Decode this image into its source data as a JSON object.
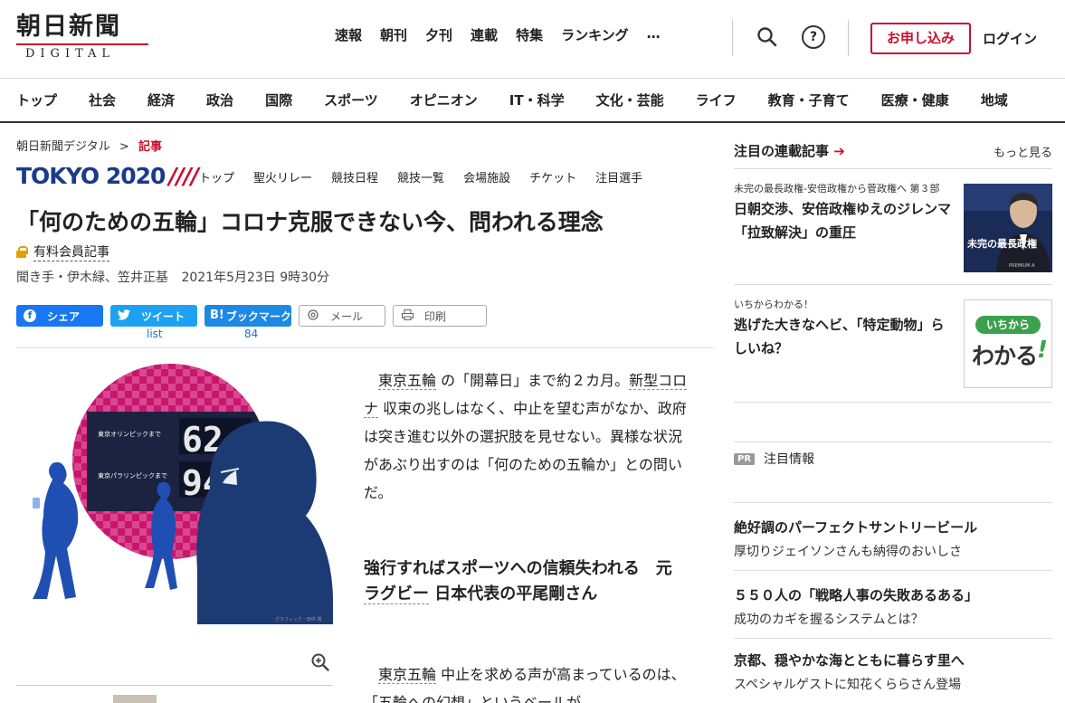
{
  "header": {
    "logo_main": "朝日新聞",
    "logo_sub": "DIGITAL",
    "topnav": [
      "速報",
      "朝刊",
      "夕刊",
      "連載",
      "特集",
      "ランキング"
    ],
    "more": "…",
    "help": "?",
    "apply": "お申し込み",
    "login": "ログイン"
  },
  "catnav": [
    "トップ",
    "社会",
    "経済",
    "政治",
    "国際",
    "スポーツ",
    "オピニオン",
    "IT・科学",
    "文化・芸能",
    "ライフ",
    "教育・子育て",
    "医療・健康",
    "地域"
  ],
  "breadcrumb": {
    "home": "朝日新聞デジタル",
    "sep": ">",
    "current": "記事"
  },
  "tokyo": {
    "logo": "TOKYO 2020",
    "slashes": "////",
    "nav": [
      "トップ",
      "聖火リレー",
      "競技日程",
      "競技一覧",
      "会場施設",
      "チケット",
      "注目選手"
    ]
  },
  "article": {
    "headline": "「何のための五輪」コロナ克服できない今、問われる理念",
    "paid_label": "有料会員記事",
    "byline": "聞き手・伊木緑、笠井正基",
    "date": "2021年5月23日 9時30分",
    "share": {
      "facebook": "シェア",
      "twitter": "ツイート",
      "twitter_count": "list",
      "hatena": "ブックマーク",
      "hatena_icon": "B!",
      "hatena_count": "84",
      "mail": "メール",
      "print": "印刷"
    },
    "para1_kw1": "東京五輪",
    "para1_a": " の「開幕日」まで約２カ月。",
    "para1_kw2": "新型コロナ",
    "para1_b": " 収束の兆しはなく、中止を望む声がなか、政府は突き進む以外の選択肢を見せない。異様な状況があぶり出すのは「何のための五輪か」との問いだ。",
    "subhead_a": "強行すればスポーツへの信頼失われる　元 ",
    "subhead_kw": "ラグビー",
    "subhead_b": " 日本代表の平尾剛さん",
    "para2_kw": "東京五輪",
    "para2": " 中止を求める声が高まっているのは、「五輪への幻想」というベールが",
    "image": {
      "board_label1": "東京オリンピックまで",
      "board_label2": "東京パラリンピックまで",
      "digits1": "62",
      "digits2": "94",
      "credit": "グラフィック・田中 潤"
    }
  },
  "sidebar": {
    "heading": "注目の連載記事",
    "heading_arrow": "➔",
    "more": "もっと見る",
    "items": [
      {
        "kicker": "未完の最長政権-安倍政権から菅政権へ 第３部",
        "title": "日朝交渉、安倍政権ゆえのジレンマ　「拉致解決」の重圧",
        "thumb_text": "未完の最長政権",
        "thumb_sub": "PREMIUM A"
      },
      {
        "kicker": "いちからわかる！",
        "title": "逃げた大きなヘビ、「特定動物」らしいね？",
        "thumb_text1": "いちから",
        "thumb_text2": "わかる",
        "thumb_mark": "!"
      }
    ],
    "pr_badge": "PR",
    "pr_label": "注目情報",
    "ads": [
      {
        "title": "絶好調のパーフェクトサントリービール",
        "sub": "厚切りジェイソンさんも納得のおいしさ"
      },
      {
        "title": "５５０人の「戦略人事の失敗あるある」",
        "sub": "成功のカギを握るシステムとは？"
      },
      {
        "title": "京都、穏やかな海とともに暮らす里へ",
        "sub": "スペシャルゲストに知花くららさん登場"
      }
    ]
  },
  "colors": {
    "brand_red": "#c8102e",
    "olympic_blue": "#1a3a8a",
    "facebook": "#1877f2",
    "twitter": "#1da1f2",
    "hatena": "#1e88e5"
  }
}
